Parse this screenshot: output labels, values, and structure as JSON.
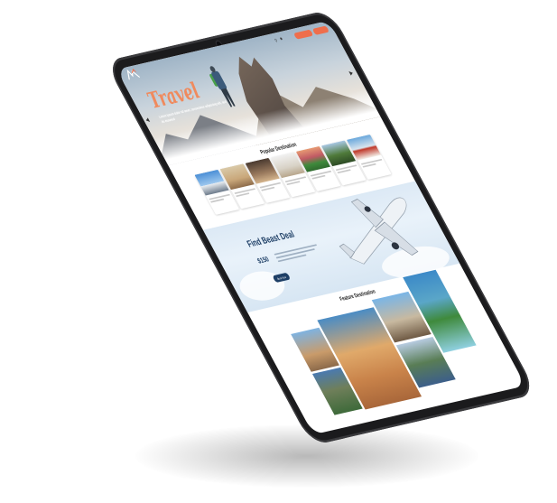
{
  "site": {
    "logo_text": "",
    "menu": [
      "",
      "",
      "",
      "",
      "",
      ""
    ],
    "login_label": "",
    "signup_label": ""
  },
  "hero": {
    "title": "Travel",
    "subtitle": "Lorem ipsum dolor sit amet, consectetur adipiscing elit, sed do eiusmod"
  },
  "popular": {
    "title": "Popular Destination",
    "cards": [
      {
        "name": ""
      },
      {
        "name": ""
      },
      {
        "name": ""
      },
      {
        "name": ""
      },
      {
        "name": ""
      },
      {
        "name": ""
      },
      {
        "name": ""
      }
    ]
  },
  "deal": {
    "title": "Find Beast Deal",
    "from_label": "",
    "price": "$150",
    "button_label": "Book Now"
  },
  "feature": {
    "title": "Feature Destination",
    "items": [
      {
        "label": ""
      },
      {
        "label": ""
      },
      {
        "label": ""
      },
      {
        "label": ""
      },
      {
        "label": ""
      },
      {
        "label": ""
      }
    ]
  },
  "colors": {
    "accent": "#ef6e4c",
    "deal_text": "#1e3f66",
    "device_frame": "#1b1b1d"
  },
  "icons": [
    "logo-icon",
    "search-icon",
    "user-icon",
    "arrow-left-icon",
    "arrow-right-icon",
    "airplane-icon",
    "camera-icon"
  ]
}
